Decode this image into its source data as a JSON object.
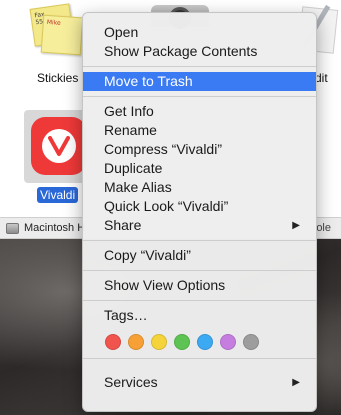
{
  "finder": {
    "apps": [
      {
        "label": "Stickies"
      },
      {
        "label": "Vivaldi"
      }
    ],
    "partial_label": "dit",
    "path_bar": {
      "disk_label": "Macintosh H",
      "right_text": "ole"
    },
    "stickies_scribbles": [
      "Fax",
      "555-7361",
      "Mike"
    ]
  },
  "context_menu": {
    "items": [
      {
        "label": "Open"
      },
      {
        "label": "Show Package Contents"
      },
      {
        "label": "Move to Trash",
        "highlighted": true
      },
      {
        "label": "Get Info"
      },
      {
        "label": "Rename"
      },
      {
        "label": "Compress “Vivaldi”"
      },
      {
        "label": "Duplicate"
      },
      {
        "label": "Make Alias"
      },
      {
        "label": "Quick Look “Vivaldi”"
      },
      {
        "label": "Share",
        "submenu": true
      },
      {
        "label": "Copy “Vivaldi”"
      },
      {
        "label": "Show View Options"
      },
      {
        "label": "Tags…"
      },
      {
        "label": "Services",
        "submenu": true
      }
    ],
    "submenu_arrow": "▶",
    "highlight_color": "#3a7af2",
    "tag_colors": [
      "#f0544d",
      "#f6a035",
      "#f4d33b",
      "#5dc453",
      "#3ca9f3",
      "#c57ee0",
      "#9d9d9d"
    ]
  }
}
